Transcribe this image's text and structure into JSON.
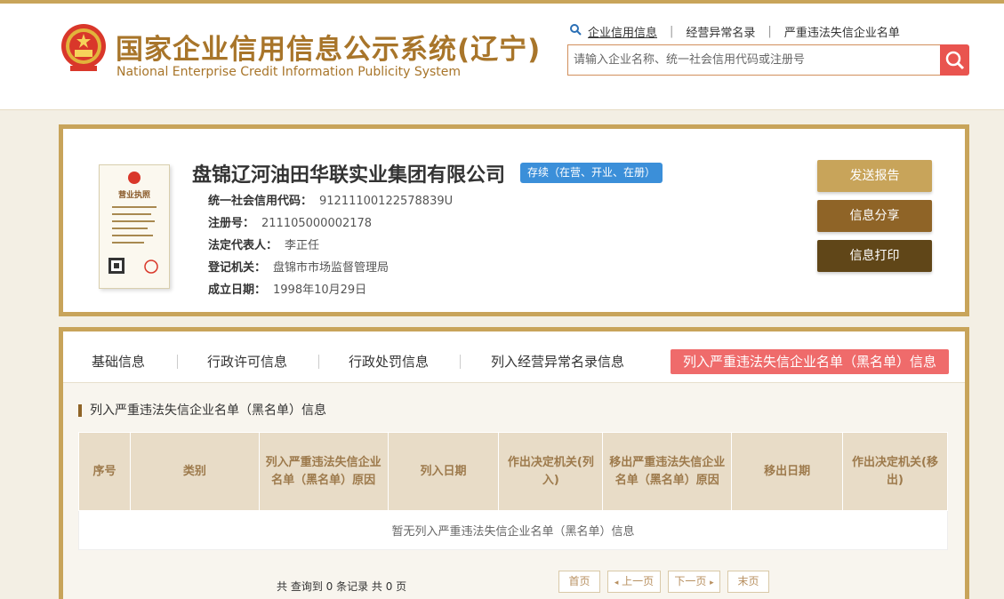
{
  "header": {
    "title_cn": "国家企业信用信息公示系统(辽宁)",
    "title_en": "National Enterprise Credit Information Publicity System",
    "nav": [
      "企业信用信息",
      "经营异常名录",
      "严重违法失信企业名单"
    ],
    "search_placeholder": "请输入企业名称、统一社会信用代码或注册号"
  },
  "company": {
    "license_label": "营业执照",
    "name": "盘锦辽河油田华联实业集团有限公司",
    "status": "存续（在营、开业、在册）",
    "fields": [
      {
        "label": "统一社会信用代码：",
        "value": "91211100122578839U"
      },
      {
        "label": "注册号：",
        "value": "211105000002178"
      },
      {
        "label": "法定代表人：",
        "value": "李正任"
      },
      {
        "label": "登记机关：",
        "value": "盘锦市市场监督管理局"
      },
      {
        "label": "成立日期：",
        "value": "1998年10月29日"
      }
    ],
    "actions": [
      "发送报告",
      "信息分享",
      "信息打印"
    ]
  },
  "tabs": [
    "基础信息",
    "行政许可信息",
    "行政处罚信息",
    "列入经营异常名录信息",
    "列入严重违法失信企业名单（黑名单）信息"
  ],
  "section": {
    "title": "列入严重违法失信企业名单（黑名单）信息",
    "columns": [
      "序号",
      "类别",
      "列入严重违法失信企业名单（黑名单）原因",
      "列入日期",
      "作出决定机关(列入)",
      "移出严重违法失信企业名单（黑名单）原因",
      "移出日期",
      "作出决定机关(移出)"
    ],
    "empty_text": "暂无列入严重违法失信企业名单（黑名单）信息",
    "pagination_info": "共 查询到 0 条记录 共 0 页",
    "pager": [
      "首页",
      "上一页",
      "下一页",
      "末页"
    ]
  },
  "colors": {
    "gold": "#c8a45a",
    "brown": "#8f6427",
    "dark_brown": "#604618",
    "red": "#e9544f",
    "blue": "#3b8fd9"
  }
}
